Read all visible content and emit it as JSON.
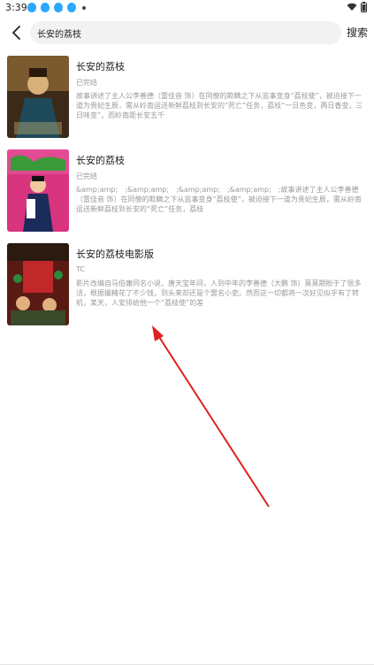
{
  "status_bar": {
    "time": "3:39",
    "icons": [
      "wifi-icon",
      "battery-icon"
    ]
  },
  "search": {
    "value": "长安的荔枝",
    "button_label": "搜索"
  },
  "results": [
    {
      "title": "长安的荔枝",
      "status": "已完结",
      "description": "故事讲述了主人公李善德（雷佳音 饰）在同僚的欺瞒之下从监事变身“荔枝使”，被迫接下一道为贵妃生辰，需从岭南运送新鲜荔枝到长安的“死亡”任务，荔枝“一日色变，两日香变，三日味变”，而岭南距长安五千",
      "poster_colors": [
        "#6b4a2a",
        "#c89a4a"
      ]
    },
    {
      "title": "长安的荔枝",
      "status": "已完结",
      "description": "&amp;amp;　;&amp;amp;　;&amp;amp;　;&amp;amp;　;故事讲述了主人公李善德（雷佳音 饰）在同僚的欺瞒之下从监事变身“荔枝使”，被迫接下一道为贵妃生辰，需从岭南运送新鲜荔枝到长安的“死亡”任务，荔枝",
      "poster_colors": [
        "#d63384",
        "#2e8b3e"
      ]
    },
    {
      "title": "长安的荔枝电影版",
      "status": "TC",
      "description": "影片改编自马伯庸同名小说，唐天宝年间，人到中年的李善德（大鹏 饰）莫莫期盼于了很多活，根据撮精花了不少钱，到头来却还是个罢名小吏。然而这一切都将一次好见似乎有了转机，某天，人安排给他一个“荔枝使”的差",
      "poster_colors": [
        "#8b1a1a",
        "#3a2a1a"
      ]
    }
  ],
  "colors": {
    "accent_arrow": "#e02020",
    "secondary_text": "#999999"
  }
}
